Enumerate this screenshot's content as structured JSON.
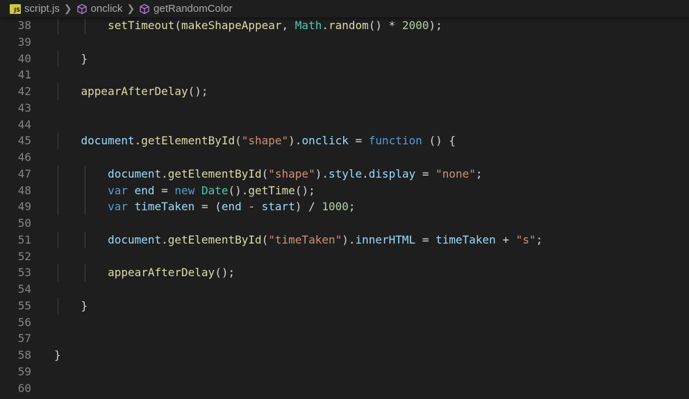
{
  "breadcrumb": {
    "file": "script.js",
    "file_icon_text": "JS",
    "items": [
      "onclick",
      "getRandomColor"
    ]
  },
  "colors": {
    "background": "#1e1e1e",
    "line_number": "#858585",
    "function": "#dcdcaa",
    "variable": "#9cdcfe",
    "class": "#4ec9b0",
    "keyword": "#569cd6",
    "string": "#ce9178",
    "number": "#b5cea8",
    "punctuation": "#d4d4d4"
  },
  "lines": [
    {
      "num": "38",
      "indent": 2,
      "tokens": [
        [
          "fn",
          "setTimeout"
        ],
        [
          "p",
          "("
        ],
        [
          "fn",
          "makeShapeAppear"
        ],
        [
          "p",
          ", "
        ],
        [
          "cls",
          "Math"
        ],
        [
          "p",
          "."
        ],
        [
          "fn",
          "random"
        ],
        [
          "p",
          "() * "
        ],
        [
          "num",
          "2000"
        ],
        [
          "p",
          ");"
        ]
      ]
    },
    {
      "num": "39",
      "indent": 0,
      "tokens": []
    },
    {
      "num": "40",
      "indent": 1,
      "tokens": [
        [
          "p",
          "}"
        ]
      ]
    },
    {
      "num": "41",
      "indent": 0,
      "tokens": []
    },
    {
      "num": "42",
      "indent": 1,
      "tokens": [
        [
          "fn",
          "appearAfterDelay"
        ],
        [
          "p",
          "();"
        ]
      ]
    },
    {
      "num": "43",
      "indent": 0,
      "tokens": []
    },
    {
      "num": "44",
      "indent": 0,
      "tokens": []
    },
    {
      "num": "45",
      "indent": 1,
      "tokens": [
        [
          "var",
          "document"
        ],
        [
          "p",
          "."
        ],
        [
          "fn",
          "getElementById"
        ],
        [
          "p",
          "("
        ],
        [
          "str",
          "\"shape\""
        ],
        [
          "p",
          ")."
        ],
        [
          "var",
          "onclick"
        ],
        [
          "p",
          " = "
        ],
        [
          "kw",
          "function"
        ],
        [
          "p",
          " () {"
        ]
      ]
    },
    {
      "num": "46",
      "indent": 0,
      "tokens": []
    },
    {
      "num": "47",
      "indent": 2,
      "tokens": [
        [
          "var",
          "document"
        ],
        [
          "p",
          "."
        ],
        [
          "fn",
          "getElementById"
        ],
        [
          "p",
          "("
        ],
        [
          "str",
          "\"shape\""
        ],
        [
          "p",
          ")."
        ],
        [
          "var",
          "style"
        ],
        [
          "p",
          "."
        ],
        [
          "var",
          "display"
        ],
        [
          "p",
          " = "
        ],
        [
          "str",
          "\"none\""
        ],
        [
          "p",
          ";"
        ]
      ]
    },
    {
      "num": "48",
      "indent": 2,
      "tokens": [
        [
          "kw",
          "var"
        ],
        [
          "p",
          " "
        ],
        [
          "var",
          "end"
        ],
        [
          "p",
          " = "
        ],
        [
          "kw",
          "new"
        ],
        [
          "p",
          " "
        ],
        [
          "cls",
          "Date"
        ],
        [
          "p",
          "()."
        ],
        [
          "fn",
          "getTime"
        ],
        [
          "p",
          "();"
        ]
      ]
    },
    {
      "num": "49",
      "indent": 2,
      "tokens": [
        [
          "kw",
          "var"
        ],
        [
          "p",
          " "
        ],
        [
          "var",
          "timeTaken"
        ],
        [
          "p",
          " = ("
        ],
        [
          "var",
          "end"
        ],
        [
          "p",
          " - "
        ],
        [
          "var",
          "start"
        ],
        [
          "p",
          ") / "
        ],
        [
          "num",
          "1000"
        ],
        [
          "p",
          ";"
        ]
      ]
    },
    {
      "num": "50",
      "indent": 0,
      "tokens": []
    },
    {
      "num": "51",
      "indent": 2,
      "tokens": [
        [
          "var",
          "document"
        ],
        [
          "p",
          "."
        ],
        [
          "fn",
          "getElementById"
        ],
        [
          "p",
          "("
        ],
        [
          "str",
          "\"timeTaken\""
        ],
        [
          "p",
          ")."
        ],
        [
          "var",
          "innerHTML"
        ],
        [
          "p",
          " = "
        ],
        [
          "var",
          "timeTaken"
        ],
        [
          "p",
          " + "
        ],
        [
          "str",
          "\"s\""
        ],
        [
          "p",
          ";"
        ]
      ]
    },
    {
      "num": "52",
      "indent": 0,
      "tokens": []
    },
    {
      "num": "53",
      "indent": 2,
      "tokens": [
        [
          "fn",
          "appearAfterDelay"
        ],
        [
          "p",
          "();"
        ]
      ]
    },
    {
      "num": "54",
      "indent": 0,
      "tokens": []
    },
    {
      "num": "55",
      "indent": 1,
      "tokens": [
        [
          "p",
          "}"
        ]
      ]
    },
    {
      "num": "56",
      "indent": 0,
      "tokens": []
    },
    {
      "num": "57",
      "indent": 0,
      "tokens": []
    },
    {
      "num": "58",
      "indent": 0,
      "tokens": [
        [
          "p",
          "}"
        ]
      ]
    },
    {
      "num": "59",
      "indent": 0,
      "tokens": []
    },
    {
      "num": "60",
      "indent": 0,
      "tokens": []
    }
  ]
}
